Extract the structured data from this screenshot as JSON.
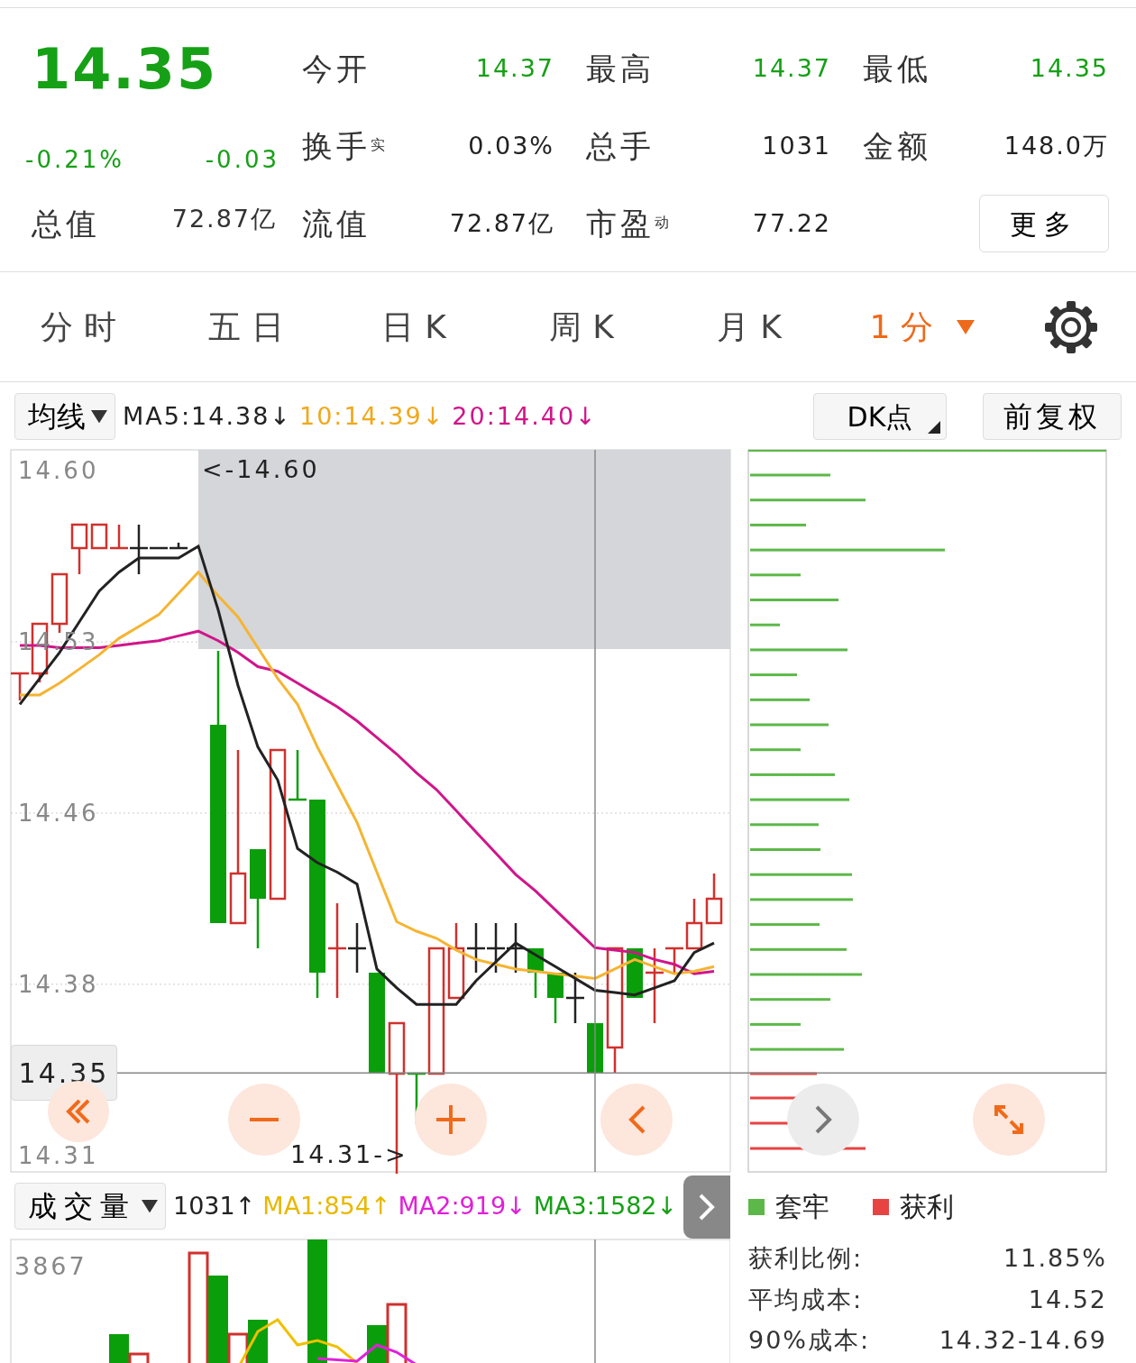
{
  "quote": {
    "price": "14.35",
    "change_percent": "-0.21%",
    "change": "-0.03",
    "market_value": {
      "label": "总值",
      "value": "72.87亿"
    },
    "stats": [
      [
        {
          "label": "今开",
          "value": "14.37",
          "color": "#16a016"
        },
        {
          "label": "最高",
          "value": "14.37",
          "color": "#16a016"
        },
        {
          "label": "最低",
          "value": "14.35",
          "color": "#16a016"
        }
      ],
      [
        {
          "label": "换手$^{实}$",
          "value": "0.03%",
          "color": "#222222"
        },
        {
          "label": "总手",
          "value": "1031",
          "color": "#222222"
        },
        {
          "label": "金额",
          "value": "148.0万",
          "color": "#222222"
        }
      ],
      [
        {
          "label": "流值",
          "value": "72.87亿",
          "color": "#222222"
        },
        {
          "label": "市盈$^{动}$",
          "value": "77.22",
          "color": "#222222"
        }
      ]
    ],
    "more_button": "更多"
  },
  "tabs": [
    {
      "label": "分时",
      "selected": false,
      "dropdown": false
    },
    {
      "label": "五日",
      "selected": false,
      "dropdown": false
    },
    {
      "label": "日K",
      "selected": false,
      "dropdown": false
    },
    {
      "label": "周K",
      "selected": false,
      "dropdown": false
    },
    {
      "label": "月K",
      "selected": false,
      "dropdown": false
    },
    {
      "label": "1分",
      "selected": true,
      "dropdown": true
    }
  ],
  "indicator_bar": {
    "selector": "均线",
    "readings": [
      {
        "text": "MA5:14.38↓",
        "color": "#222222"
      },
      {
        "text": "10:14.39↓",
        "color": "#f0a81c"
      },
      {
        "text": "20:14.40↓",
        "color": "#d0158a"
      }
    ],
    "dk_button": "DK点",
    "adjust_button": "前复权"
  },
  "price_chart": {
    "chart_data": {
      "type": "line",
      "categories": [
        null,
        null,
        null,
        null,
        null,
        null,
        null,
        null,
        null,
        null,
        null,
        null,
        null,
        null,
        null,
        null,
        null,
        null,
        null,
        null,
        null,
        null,
        null,
        null,
        null,
        null,
        null,
        null,
        null,
        null,
        null,
        null,
        null,
        null,
        null,
        null
      ],
      "ylim": [
        14.3031,
        14.6084
      ],
      "grid": true,
      "ref_lines": [
        {
          "axis": "y",
          "value": 14.345,
          "label": "14.35"
        }
      ],
      "yticks": [
        {
          "value": 14.6,
          "label": "14.60"
        },
        {
          "value": 14.5275,
          "label": "14.53"
        },
        {
          "value": 14.455,
          "label": "14.46"
        },
        {
          "value": 14.3825,
          "label": "14.38"
        },
        {
          "value": 14.31,
          "label": "14.31"
        }
      ],
      "series": [
        {
          "color": "#d0158a",
          "values": [
            14.526,
            14.526,
            14.525,
            14.525,
            14.525,
            14.526,
            14.527,
            14.528,
            14.53,
            14.532,
            14.528,
            14.523,
            14.517,
            14.515,
            14.51,
            14.505,
            14.5,
            14.494,
            14.487,
            14.48,
            14.472,
            14.465,
            14.456,
            14.447,
            14.438,
            14.429,
            14.422,
            14.414,
            14.406,
            14.398,
            14.397,
            14.396,
            14.393,
            14.391,
            14.387,
            14.388
          ]
        },
        {
          "color": "#f5b431",
          "values": [
            14.505,
            14.505,
            14.51,
            14.516,
            14.522,
            14.529,
            14.534,
            14.539,
            14.548,
            14.557,
            14.547,
            14.538,
            14.525,
            14.512,
            14.501,
            14.483,
            14.467,
            14.451,
            14.43,
            14.409,
            14.405,
            14.402,
            14.397,
            14.393,
            14.391,
            14.389,
            14.388,
            14.387,
            14.386,
            14.385,
            14.389,
            14.393,
            14.39,
            14.387,
            14.388,
            14.39
          ]
        },
        {
          "color": "#222222",
          "values": [
            14.501,
            14.512,
            14.523,
            14.536,
            14.549,
            14.557,
            14.563,
            14.563,
            14.563,
            14.568,
            14.541,
            14.509,
            14.483,
            14.469,
            14.44,
            14.434,
            14.43,
            14.425,
            14.389,
            14.381,
            14.374,
            14.374,
            14.374,
            14.384,
            14.392,
            14.4,
            14.395,
            14.39,
            14.385,
            14.38,
            14.379,
            14.378,
            14.381,
            14.384,
            14.396,
            14.4
          ]
        }
      ]
    },
    "high_marker": "<-14.60",
    "low_marker": "14.31->",
    "controls": [
      {
        "kind": "fast-back",
        "disabled": false
      },
      {
        "kind": "zoom-out",
        "disabled": false
      },
      {
        "kind": "zoom-in",
        "disabled": false
      },
      {
        "kind": "previous",
        "disabled": false
      },
      {
        "kind": "next",
        "disabled": true
      },
      {
        "kind": "fullscreen",
        "disabled": false
      }
    ]
  },
  "volume_bar": {
    "selector": "成交量",
    "readings": [
      {
        "text": "1031↑",
        "color": "#222222"
      },
      {
        "text": "MA1:854↑",
        "color": "#e8b800"
      },
      {
        "text": "MA2:919↓",
        "color": "#e020d8"
      },
      {
        "text": "MA3:1582↓",
        "color": "#16a016"
      }
    ]
  },
  "volume_chart": {
    "axis_label": "3867"
  },
  "chips": {
    "legend": [
      {
        "label": "套牢",
        "color": "#5cb848"
      },
      {
        "label": "获利",
        "color": "#e84343"
      }
    ],
    "stats": [
      {
        "label": "获利比例:",
        "value": "11.85%"
      },
      {
        "label": "平均成本:",
        "value": "14.52"
      },
      {
        "label": "90%成本:",
        "value": "14.32-14.69"
      }
    ]
  }
}
